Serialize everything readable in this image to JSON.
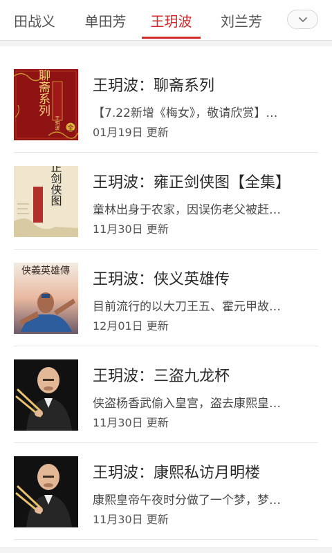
{
  "tabs": [
    {
      "label": "田战义",
      "active": false
    },
    {
      "label": "单田芳",
      "active": false
    },
    {
      "label": "王玥波",
      "active": true
    },
    {
      "label": "刘兰芳",
      "active": false
    }
  ],
  "more_icon": "chevron-down-icon",
  "items": [
    {
      "title": "王玥波：聊斋系列",
      "desc": "【7.22新增《梅女》，敬请欣赏】…",
      "date": "01月19日 更新",
      "cover_title": "聊斋系列",
      "cover_author": "王玥波",
      "cover_badge": "全"
    },
    {
      "title": "王玥波：雍正剑侠图【全集】",
      "desc": "童林出身于农家，因误伤老父被赶…",
      "date": "11月30日 更新",
      "cover_title": "雍正剑侠图"
    },
    {
      "title": "王玥波：侠义英雄传",
      "desc": "目前流行的以大刀王五、霍元甲故…",
      "date": "12月01日 更新",
      "cover_title": "侠義英雄傳"
    },
    {
      "title": "王玥波：三盗九龙杯",
      "desc": "侠盗杨香武偷入皇宫，盗去康熙皇…",
      "date": "11月30日 更新"
    },
    {
      "title": "王玥波：康熙私访月明楼",
      "desc": "康熙皇帝午夜时分做了一个梦，梦…",
      "date": "11月30日 更新"
    }
  ]
}
